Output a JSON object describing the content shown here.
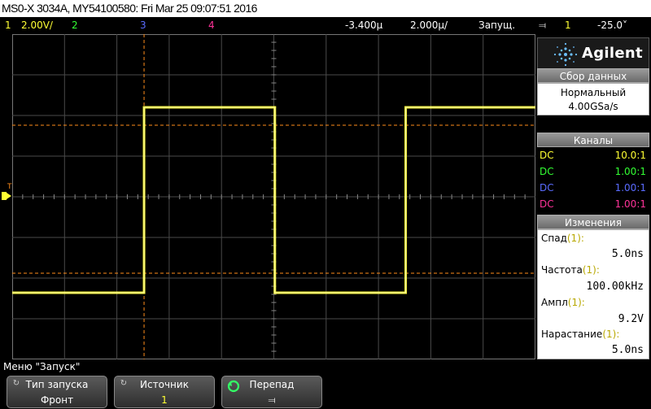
{
  "title": "MS0-X 3034A, MY54100580: Fri Mar 25 09:07:51 2016",
  "status": {
    "ch1_num": "1",
    "ch1_scale": "2.00V/",
    "ch2_num": "2",
    "ch3_num": "3",
    "ch4_num": "4",
    "time_offset": "-3.400µ",
    "time_scale": "2.000µ/",
    "run_state": "Запущ.",
    "trig_icon": "trigger-edge-icon",
    "trig_glyph": "⫤",
    "trig_channel": "1",
    "trig_level": "-25.0˅"
  },
  "colors": {
    "ch1": "#ffff33",
    "ch2": "#33ff33",
    "ch3": "#5a6cff",
    "ch4": "#ff3399",
    "trigger": "#ff8c1a",
    "grid": "#4a4a4a"
  },
  "logo": {
    "brand": "Agilent"
  },
  "acquisition": {
    "header": "Сбор данных",
    "mode": "Нормальный",
    "rate": "4.00GSa/s"
  },
  "channels": {
    "header": "Каналы",
    "rows": [
      {
        "coupling": "DC",
        "probe": "10.0:1"
      },
      {
        "coupling": "DC",
        "probe": "1.00:1"
      },
      {
        "coupling": "DC",
        "probe": "1.00:1"
      },
      {
        "coupling": "DC",
        "probe": "1.00:1"
      }
    ]
  },
  "measurements": {
    "header": "Изменения",
    "items": [
      {
        "label": "Спад",
        "src": "(1):",
        "value": "5.0ns"
      },
      {
        "label": "Частота",
        "src": "(1):",
        "value": "100.00kHz"
      },
      {
        "label": "Ампл",
        "src": "(1):",
        "value": "9.2V"
      },
      {
        "label": "Нарастание",
        "src": "(1):",
        "value": "5.0ns"
      }
    ]
  },
  "screen_markers": {
    "ground_label": "1",
    "trig_marker": "T"
  },
  "menu": {
    "title": "Меню \"Запуск\"",
    "softkeys": [
      {
        "label": "Тип запуска",
        "value": "Фронт"
      },
      {
        "label": "Источник",
        "value": "1"
      },
      {
        "label": "Перепад",
        "value": "⫤"
      }
    ]
  }
}
